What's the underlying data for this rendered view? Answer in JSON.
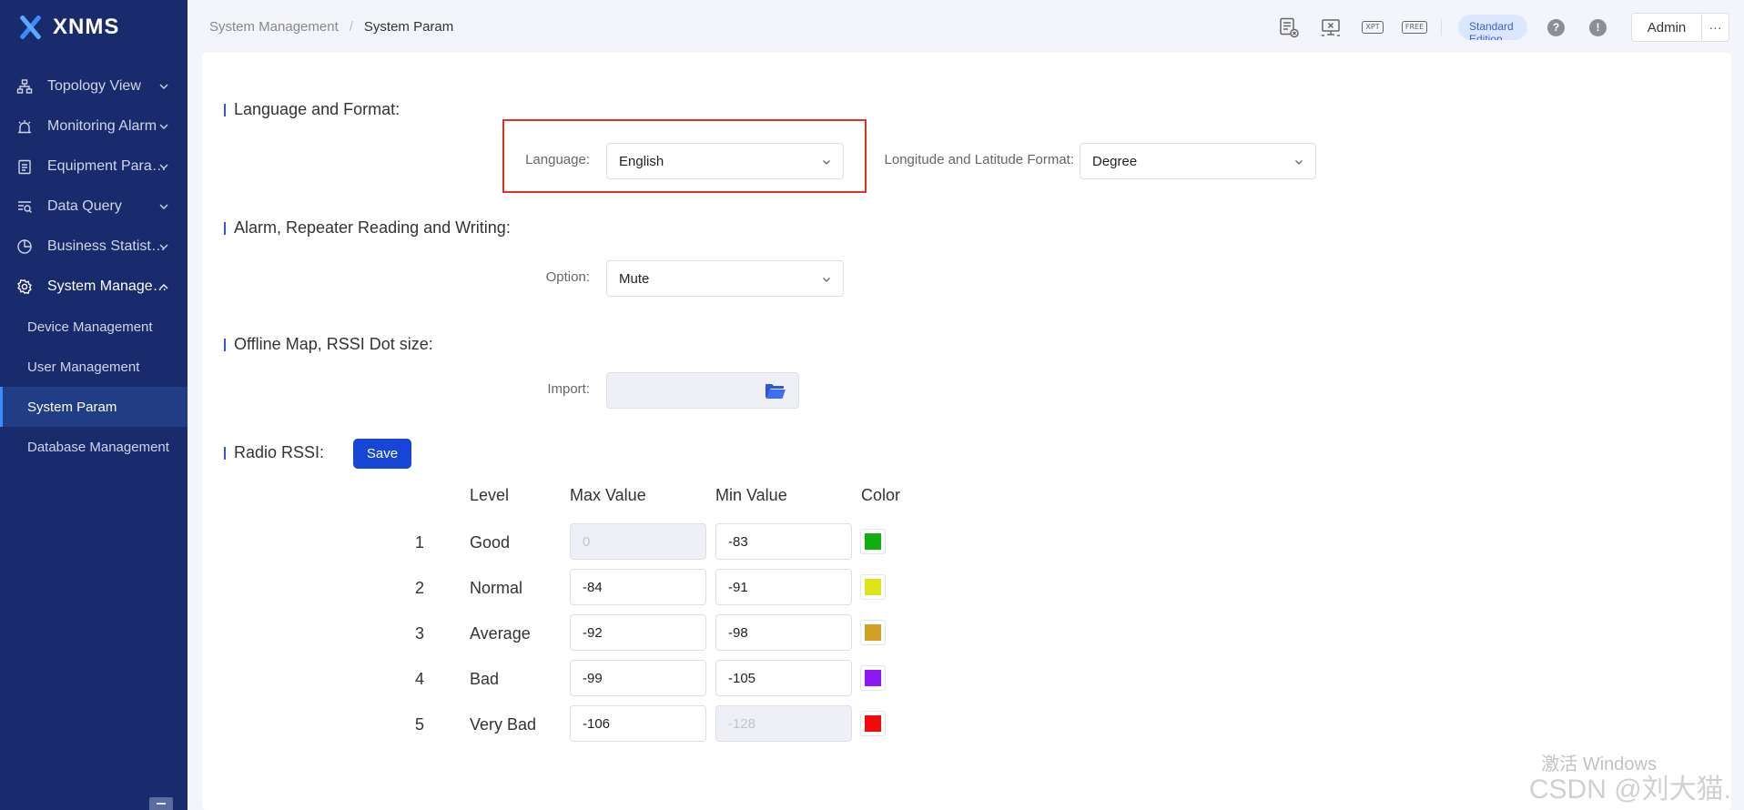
{
  "app": {
    "logo_text": "XNMS"
  },
  "sidebar": {
    "menu": [
      {
        "label": "Topology View",
        "icon": "topology-icon"
      },
      {
        "label": "Monitoring Alarm",
        "icon": "alarm-icon"
      },
      {
        "label": "Equipment Parameters",
        "icon": "clipboard-icon"
      },
      {
        "label": "Data Query",
        "icon": "query-icon"
      },
      {
        "label": "Business Statistics",
        "icon": "pie-chart-icon"
      },
      {
        "label": "System Management",
        "icon": "gear-icon"
      }
    ],
    "submenu": [
      {
        "label": "Device Management"
      },
      {
        "label": "User Management"
      },
      {
        "label": "System Param",
        "active": true
      },
      {
        "label": "Database Management"
      }
    ]
  },
  "header": {
    "breadcrumb": [
      "System Management",
      "System Param"
    ],
    "breadcrumb_separator": "/",
    "tools": [
      "report-icon",
      "monitor-icon",
      "xpt-icon",
      "free-icon"
    ],
    "tool_badges": {
      "xpt": "XPT",
      "free": "FREE"
    },
    "edition": "Standard Edition",
    "help_glyph": "?",
    "info_glyph": "!",
    "user": "Admin",
    "more": "···"
  },
  "sections": {
    "language_format": "Language and Format:",
    "alarm_reading": "Alarm, Repeater Reading and Writing:",
    "offline_map": "Offline Map, RSSI Dot size:",
    "radio_rssi": "Radio RSSI:"
  },
  "fields": {
    "language": {
      "label": "Language:",
      "value": "English"
    },
    "lonlat_format": {
      "label": "Longitude and Latitude Format:",
      "value": "Degree"
    },
    "option": {
      "label": "Option:",
      "value": "Mute"
    },
    "import": {
      "label": "Import:"
    }
  },
  "save_label": "Save",
  "rssi_table": {
    "headers": {
      "level": "Level",
      "max": "Max Value",
      "min": "Min Value",
      "color": "Color"
    },
    "rows": [
      {
        "num": "1",
        "level": "Good",
        "max": "0",
        "min": "-83",
        "color": "#11ad11",
        "max_disabled": true,
        "min_disabled": false
      },
      {
        "num": "2",
        "level": "Normal",
        "max": "-84",
        "min": "-91",
        "color": "#dde41a",
        "max_disabled": false,
        "min_disabled": false
      },
      {
        "num": "3",
        "level": "Average",
        "max": "-92",
        "min": "-98",
        "color": "#d2a022",
        "max_disabled": false,
        "min_disabled": false
      },
      {
        "num": "4",
        "level": "Bad",
        "max": "-99",
        "min": "-105",
        "color": "#8f18f2",
        "max_disabled": false,
        "min_disabled": false
      },
      {
        "num": "5",
        "level": "Very Bad",
        "max": "-106",
        "min": "-128",
        "color": "#f20b0b",
        "max_disabled": false,
        "min_disabled": true
      }
    ]
  },
  "watermark": {
    "line1": "激活 Windows",
    "line2": "CSDN @刘大猫."
  },
  "colors": {
    "sidebar_bg": "#1a2b6d",
    "primary": "#1746d6",
    "highlight": "#e3321f",
    "accent": "#3357d8"
  }
}
